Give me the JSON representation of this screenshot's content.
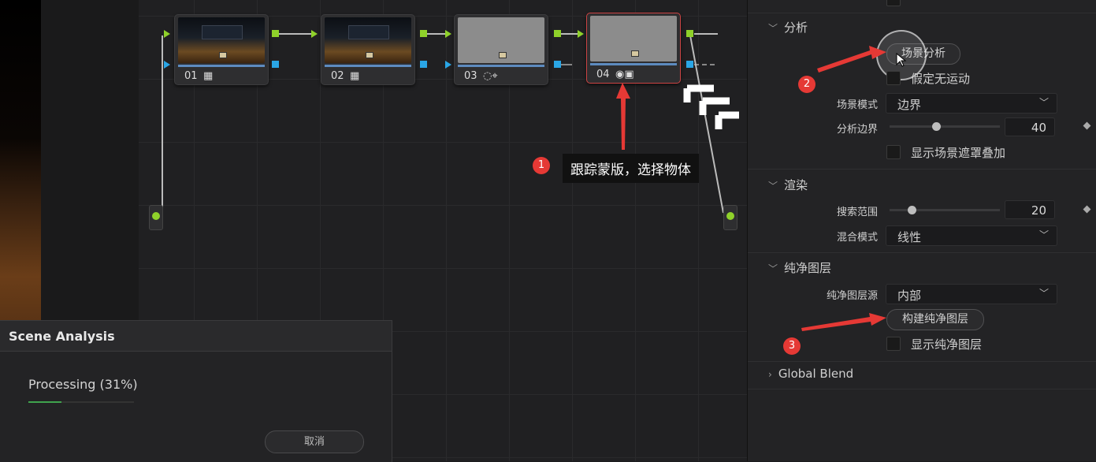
{
  "nodes": [
    {
      "label": "01",
      "icon": "grid-icon",
      "icon_glyph": "▦"
    },
    {
      "label": "02",
      "icon": "grid-icon",
      "icon_glyph": "▦"
    },
    {
      "label": "03",
      "icon": "mask-tracker-icon",
      "icon_glyph": "◌⌖"
    },
    {
      "label": "04",
      "icon": "object-mask-icon",
      "icon_glyph": "◉▣"
    }
  ],
  "annotations": {
    "step1": {
      "number": "1",
      "text": "跟踪蒙版，选择物体"
    },
    "step2": {
      "number": "2"
    },
    "step3": {
      "number": "3"
    }
  },
  "dialog": {
    "title": "Scene Analysis",
    "status": "Processing  (31%)",
    "progress": 0.31,
    "cancel_label": "取消"
  },
  "inspector": {
    "analysis": {
      "section_label": "分析",
      "scene_analysis_button": "场景分析",
      "assume_no_motion_label": "假定无运动",
      "scene_mode_label": "场景模式",
      "scene_mode_value": "边界",
      "analysis_border_label": "分析边界",
      "analysis_border_value": "40",
      "analysis_border_fraction": 0.42,
      "show_scene_mask_label": "显示场景遮罩叠加"
    },
    "render": {
      "section_label": "渲染",
      "search_range_label": "搜索范围",
      "search_range_value": "20",
      "search_range_fraction": 0.2,
      "blend_mode_label": "混合模式",
      "blend_mode_value": "线性"
    },
    "clean_plate": {
      "section_label": "纯净图层",
      "source_label": "纯净图层源",
      "source_value": "内部",
      "build_button": "构建纯净图层",
      "show_label": "显示纯净图层"
    },
    "global_blend": {
      "section_label": "Global Blend"
    }
  },
  "colors": {
    "accent_red": "#e53935",
    "port_green": "#8fd12a",
    "port_blue": "#2aa6e6",
    "progress_green": "#3fa34d"
  }
}
